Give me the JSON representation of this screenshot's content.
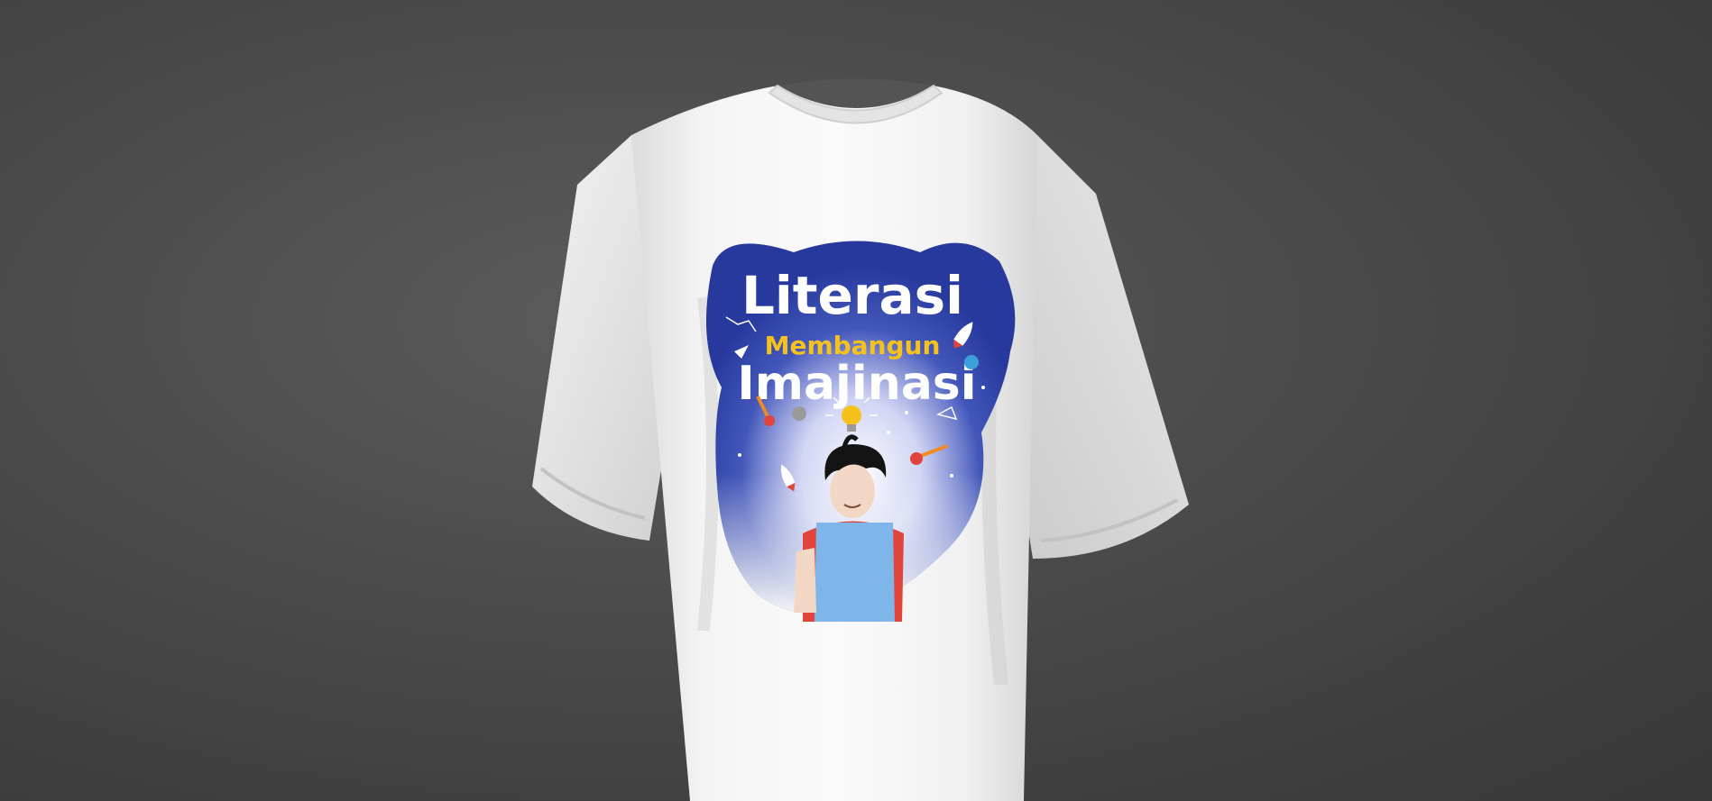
{
  "viewer": {
    "background_color": "#474747",
    "garment": {
      "type": "oversized t-shirt",
      "shirt_color": "#f2f2f2"
    }
  },
  "print": {
    "line1": "Literasi",
    "line2": "Membangun",
    "line3": "Imajinasi",
    "colors": {
      "backdrop": "#2b3fa3",
      "line1": "#ffffff",
      "line2": "#f4c21b",
      "line3": "#ffffff",
      "shirt_child": "#7fb6ea",
      "sleeve": "#e0443a",
      "hair": "#141414"
    },
    "icons": [
      "rocket-icon",
      "lightbulb-icon",
      "planet-icon",
      "moon-icon",
      "comet-icon",
      "paper-plane-icon",
      "constellation-icon",
      "star-icon"
    ]
  }
}
